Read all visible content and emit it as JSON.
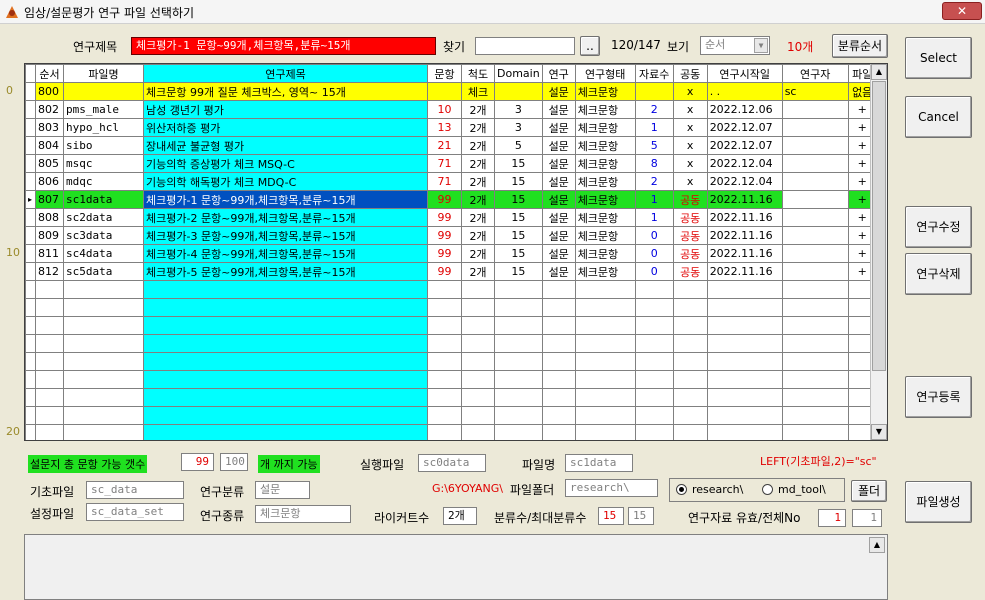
{
  "window": {
    "title": "임상/설문평가 연구 파일 선택하기",
    "close": "✕"
  },
  "top": {
    "study_title_label": "연구제목",
    "study_title_value": "체크평가-1 문항~99개,체크항목,분류~15개",
    "find_label": "찾기",
    "find_value": "",
    "find_btn": "..",
    "count": "120/147",
    "view_label": "보기",
    "view_value": "순서",
    "count_red": "10개",
    "sort_btn": "분류순서"
  },
  "side_buttons": {
    "select": "Select",
    "cancel": "Cancel",
    "edit": "연구수정",
    "delete": "연구삭제",
    "register": "연구등록",
    "create_file": "파일생성"
  },
  "row_markers": [
    "0",
    "10",
    "20"
  ],
  "columns": [
    "순서",
    "파일명",
    "연구제목",
    "문항",
    "척도",
    "Domain",
    "연구",
    "연구형태",
    "자료수",
    "공동",
    "연구시작일",
    "연구자",
    "파일"
  ],
  "rows": [
    {
      "no": "800",
      "file": "",
      "title": "체크문항 99개 질문 체크박스, 영역~ 15개",
      "q": "",
      "scale": "체크",
      "dom": "",
      "kind": "설문",
      "form": "체크문항",
      "data": "",
      "co": "x",
      "date": ". .",
      "res": "sc",
      "f": "없음",
      "style": "yellow"
    },
    {
      "no": "802",
      "file": "pms_male",
      "title": "남성 갱년기 평가",
      "q": "10",
      "scale": "2개",
      "dom": "3",
      "kind": "설문",
      "form": "체크문항",
      "data": "2",
      "co": "x",
      "date": "2022.12.06",
      "res": "",
      "f": "+",
      "style": ""
    },
    {
      "no": "803",
      "file": "hypo_hcl",
      "title": "위산저하증 평가",
      "q": "13",
      "scale": "2개",
      "dom": "3",
      "kind": "설문",
      "form": "체크문항",
      "data": "1",
      "co": "x",
      "date": "2022.12.07",
      "res": "",
      "f": "+",
      "style": ""
    },
    {
      "no": "804",
      "file": "sibo",
      "title": "장내세균 불균형 평가",
      "q": "21",
      "scale": "2개",
      "dom": "5",
      "kind": "설문",
      "form": "체크문항",
      "data": "5",
      "co": "x",
      "date": "2022.12.07",
      "res": "",
      "f": "+",
      "style": ""
    },
    {
      "no": "805",
      "file": "msqc",
      "title": "기능의학 증상평가 체크 MSQ-C",
      "q": "71",
      "scale": "2개",
      "dom": "15",
      "kind": "설문",
      "form": "체크문항",
      "data": "8",
      "co": "x",
      "date": "2022.12.04",
      "res": "",
      "f": "+",
      "style": ""
    },
    {
      "no": "806",
      "file": "mdqc",
      "title": "기능의학 해독평가 체크 MDQ-C",
      "q": "71",
      "scale": "2개",
      "dom": "15",
      "kind": "설문",
      "form": "체크문항",
      "data": "2",
      "co": "x",
      "date": "2022.12.04",
      "res": "",
      "f": "+",
      "style": ""
    },
    {
      "no": "807",
      "file": "sc1data",
      "title": "체크평가-1 문항~99개,체크항목,분류~15개",
      "q": "99",
      "scale": "2개",
      "dom": "15",
      "kind": "설문",
      "form": "체크문항",
      "data": "1",
      "co": "공동",
      "date": "2022.11.16",
      "res": "",
      "f": "+",
      "style": "green"
    },
    {
      "no": "808",
      "file": "sc2data",
      "title": "체크평가-2 문항~99개,체크항목,분류~15개",
      "q": "99",
      "scale": "2개",
      "dom": "15",
      "kind": "설문",
      "form": "체크문항",
      "data": "1",
      "co": "공동",
      "date": "2022.11.16",
      "res": "",
      "f": "+",
      "style": ""
    },
    {
      "no": "809",
      "file": "sc3data",
      "title": "체크평가-3 문항~99개,체크항목,분류~15개",
      "q": "99",
      "scale": "2개",
      "dom": "15",
      "kind": "설문",
      "form": "체크문항",
      "data": "0",
      "co": "공동",
      "date": "2022.11.16",
      "res": "",
      "f": "+",
      "style": ""
    },
    {
      "no": "811",
      "file": "sc4data",
      "title": "체크평가-4 문항~99개,체크항목,분류~15개",
      "q": "99",
      "scale": "2개",
      "dom": "15",
      "kind": "설문",
      "form": "체크문항",
      "data": "0",
      "co": "공동",
      "date": "2022.11.16",
      "res": "",
      "f": "+",
      "style": ""
    },
    {
      "no": "812",
      "file": "sc5data",
      "title": "체크평가-5 문항~99개,체크항목,분류~15개",
      "q": "99",
      "scale": "2개",
      "dom": "15",
      "kind": "설문",
      "form": "체크문항",
      "data": "0",
      "co": "공동",
      "date": "2022.11.16",
      "res": "",
      "f": "+",
      "style": ""
    }
  ],
  "empty_rows": 9,
  "bottom": {
    "max_q_label": "설문지 총 문항 가능 갯수",
    "max_q_value": "99",
    "max_q_value2": "100",
    "max_q_suffix": "개 까지 가능",
    "exec_label": "실행파일",
    "exec_value": "sc0data",
    "file_label": "파일명",
    "file_value": "sc1data",
    "formula": "LEFT(기초파일,2)=\"sc\"",
    "base_label": "기초파일",
    "base_value": "sc_data",
    "cat_label": "연구분류",
    "cat_value": "설문",
    "path_red": "G:\\6YOYANG\\",
    "folder_label": "파일폴더",
    "folder_value": "research\\",
    "radio1": "research\\",
    "radio2": "md_tool\\",
    "folder_btn": "폴더",
    "set_label": "설정파일",
    "set_value": "sc_data_set",
    "type_label": "연구종류",
    "type_value": "체크문항",
    "likert_label": "라이커트수",
    "likert_value": "2개",
    "class_label": "분류수/최대분류수",
    "class_value": "15",
    "class_max": "15",
    "valid_label": "연구자료 유효/전체No",
    "valid_value": "1",
    "valid_total": "1"
  }
}
